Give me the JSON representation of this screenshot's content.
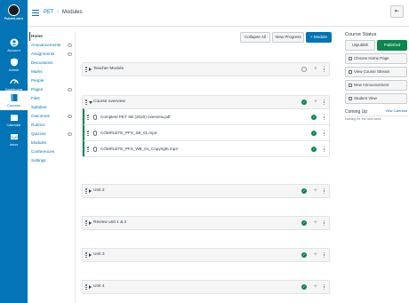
{
  "global_nav": {
    "logo_label": "FutureLearn",
    "items": [
      {
        "label": "Account",
        "icon": "user-icon"
      },
      {
        "label": "Admin",
        "icon": "shield-icon"
      },
      {
        "label": "Dashboard",
        "icon": "dashboard-icon"
      },
      {
        "label": "Courses",
        "icon": "book-icon"
      },
      {
        "label": "Calendar",
        "icon": "calendar-icon"
      },
      {
        "label": "Inbox",
        "icon": "inbox-icon"
      }
    ]
  },
  "breadcrumb": {
    "course": "PET",
    "separator": "›",
    "current": "Modules"
  },
  "course_nav": [
    "Home",
    "Announcements",
    "Assignments",
    "Discussions",
    "Marks",
    "People",
    "Pages",
    "Files",
    "Syllabus",
    "Outcomes",
    "Rubrics",
    "Quizzes",
    "Modules",
    "Conferences",
    "Settings"
  ],
  "toolbar": {
    "collapse_all": "Collapse All",
    "view_progress": "View Progress",
    "add_module": "+ Module"
  },
  "modules": [
    {
      "title": "Teacher Module",
      "items": []
    },
    {
      "title": "Course overview",
      "items": [
        "Complete PET SB (2020) overview.pdf",
        "COMPLETE_PFS_SB_01.mp3",
        "COMPLETE_PFS_WB_01_Copyright.mp3"
      ]
    },
    {
      "title": "Unit 2",
      "items": []
    },
    {
      "title": "Review unit 1 & 2",
      "items": []
    },
    {
      "title": "Unit 3",
      "items": []
    },
    {
      "title": "Unit 4",
      "items": []
    }
  ],
  "sidebar": {
    "status_title": "Course Status",
    "unpublish": "Unpublish",
    "published": "Published",
    "buttons": [
      "Choose Home Page",
      "View Course Stream",
      "New Announcement",
      "Student View"
    ],
    "coming_up": "Coming Up",
    "view_calendar": "View Calendar",
    "nothing": "Nothing for the next week"
  },
  "colors": {
    "brand": "#0374b5",
    "success": "#0b874b"
  }
}
